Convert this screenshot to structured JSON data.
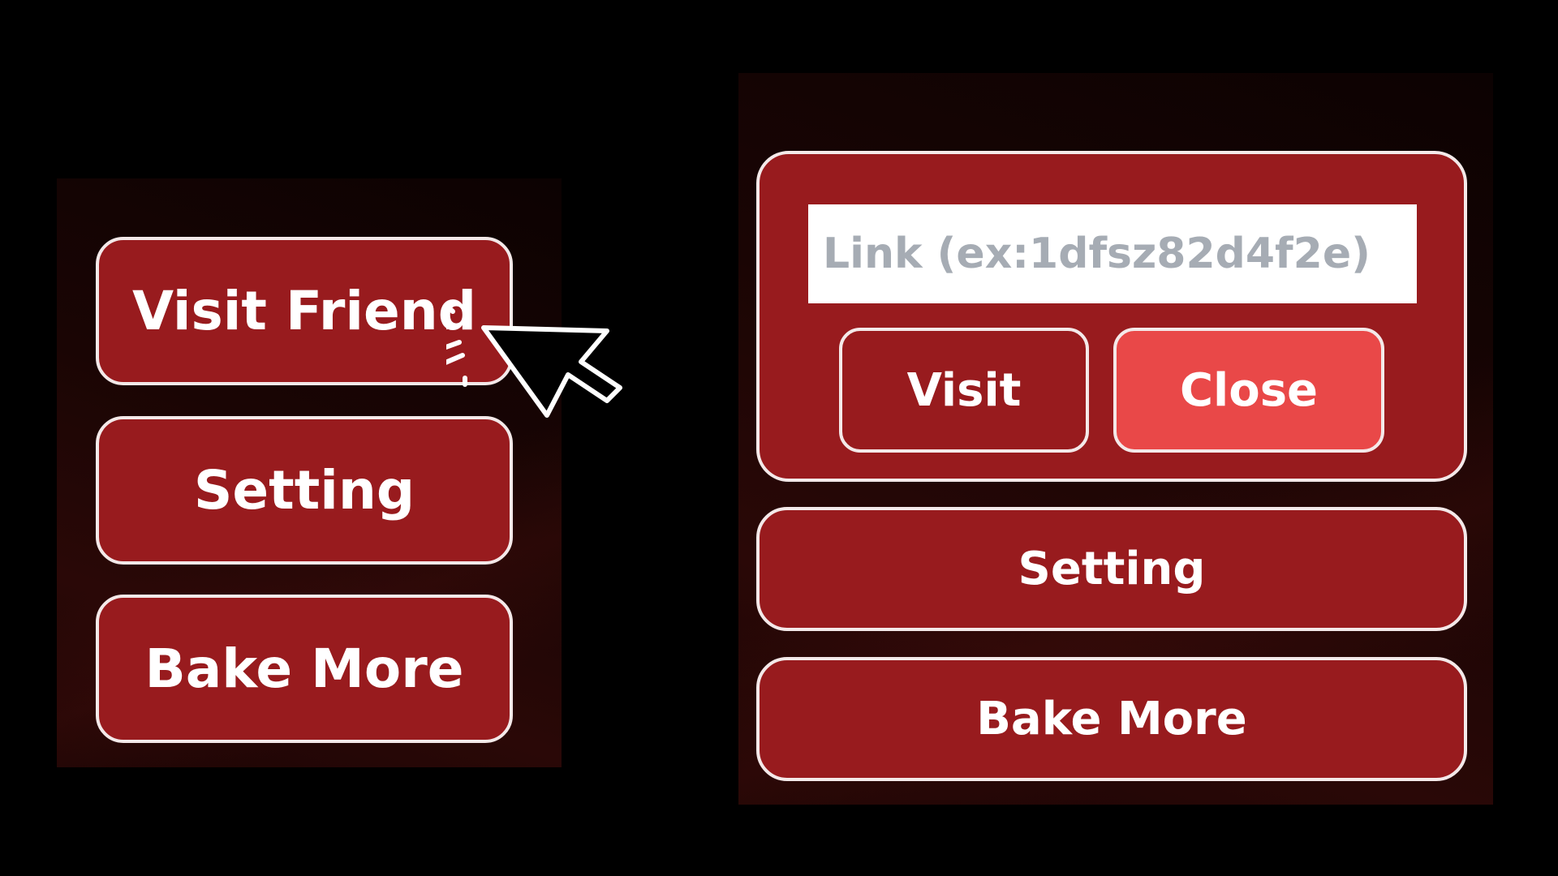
{
  "left_menu": {
    "visit_friend_label": "Visit Friend",
    "setting_label": "Setting",
    "bake_more_label": "Bake More"
  },
  "right_menu": {
    "link_dialog": {
      "input_placeholder": "Link (ex:1dfsz82d4f2e)",
      "input_value": "",
      "visit_label": "Visit",
      "close_label": "Close"
    },
    "setting_label": "Setting",
    "bake_more_label": "Bake More"
  },
  "colors": {
    "button_fill": "#981b1e",
    "button_border": "#f4e9e9",
    "close_fill": "#e94848",
    "background": "#000000"
  },
  "icons": {
    "cursor": "click-cursor-icon"
  }
}
